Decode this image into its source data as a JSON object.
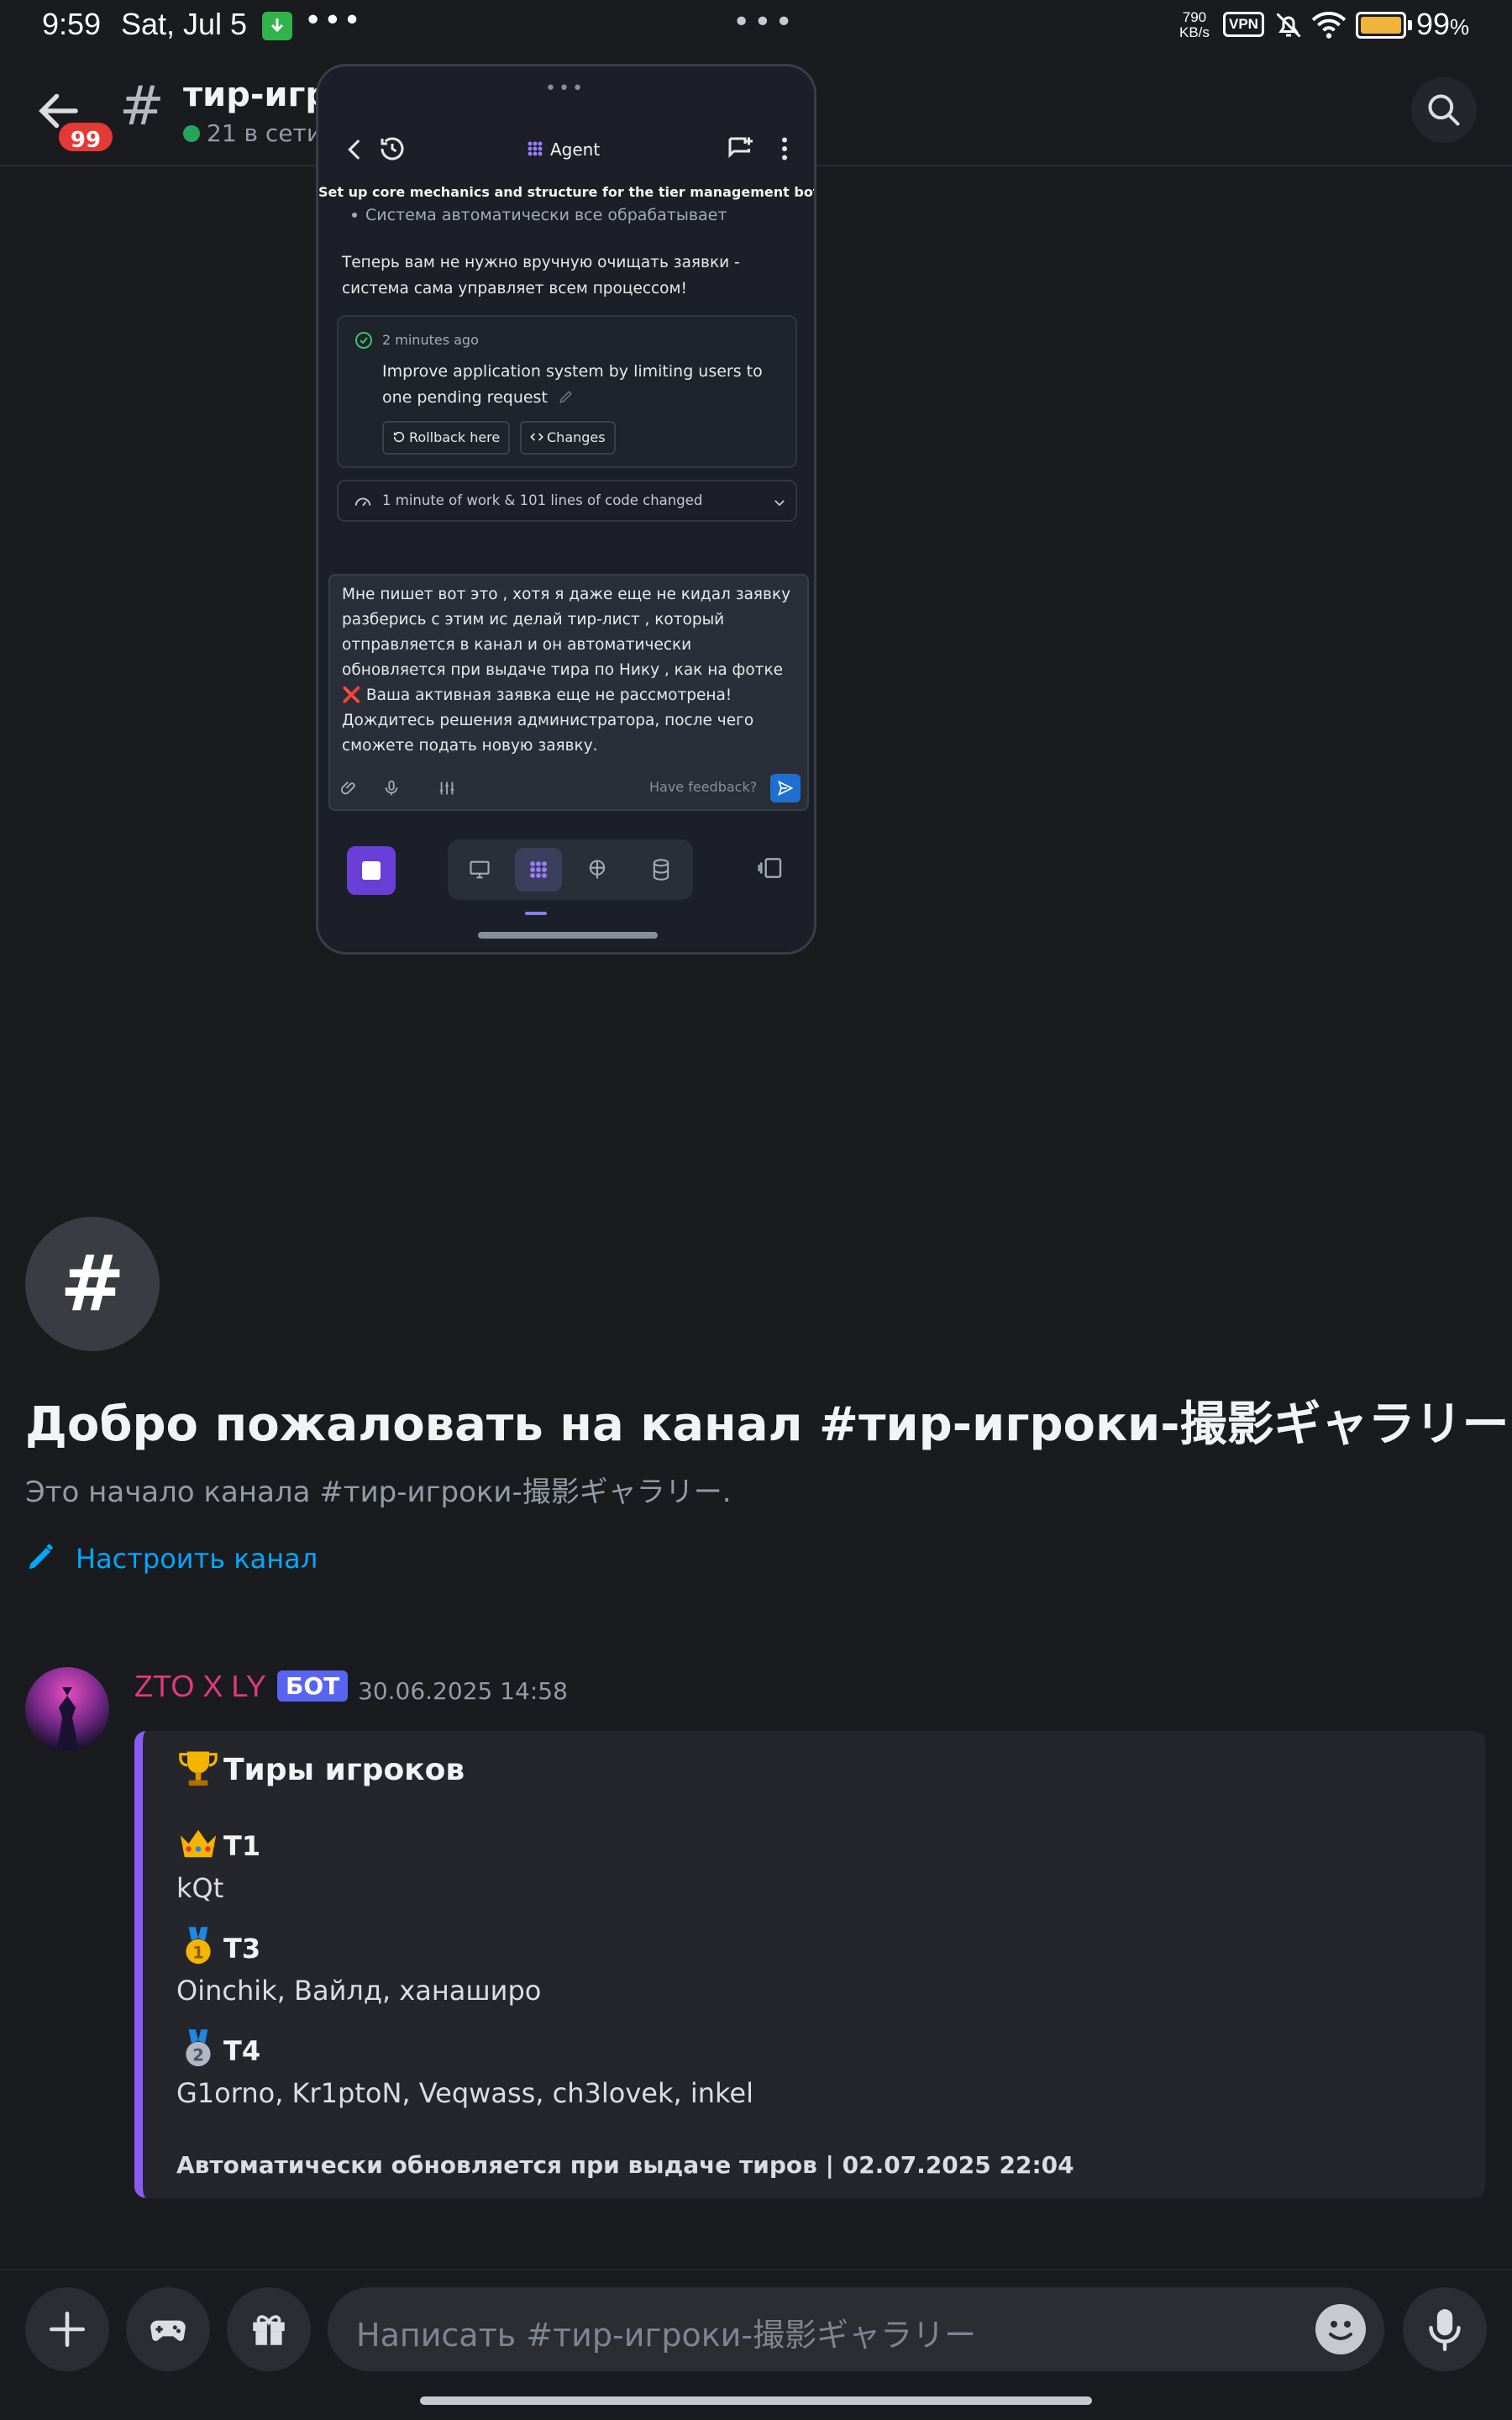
{
  "status_bar": {
    "time": "9:59",
    "date": "Sat, Jul 5",
    "more": "•••",
    "center_dots": "•••",
    "speed_value": "790",
    "speed_unit": "KB/s",
    "vpn": "VPN",
    "battery": "99",
    "battery_unit": "%",
    "battery_color": "#f0b43a"
  },
  "header": {
    "unread_badge": "99",
    "hash": "#",
    "channel_name": "тир-игр",
    "online": "21 в сети"
  },
  "agent_window": {
    "title": "Agent",
    "task_title": "Set up core mechanics and structure for the tier management bot",
    "bullet": "Система автоматически все обрабатывает",
    "paragraph": "Теперь вам не нужно вручную очищать заявки - система сама управляет всем процессом!",
    "checkpoint": {
      "time": "2 minutes ago",
      "text": "Improve application system by limiting users to one pending request",
      "rollback": "Rollback here",
      "changes": "Changes"
    },
    "work_summary": "1 minute of work & 101 lines of code changed",
    "input_text": "Мне пишет вот это , хотя я даже еще не кидал заявку разберись с этим ис делай тир-лист , который отправляется в канал и он автоматически обновляется при выдаче тира по Нику , как на фотке ❌ Ваша активная заявка еще не рассмотрена! Дождитесь решения администратора, после чего сможете подать новую заявку.",
    "feedback": "Have feedback?",
    "accent": "#6a3fd8"
  },
  "welcome": {
    "icon": "#",
    "title": "Добро пожаловать на канал #тир-игроки-撮影ギャラリー!",
    "subtitle": "Это начало канала #тир-игроки-撮影ギャラリー.",
    "setup_link": "Настроить канал"
  },
  "message": {
    "author": "ZTO X LY",
    "author_color": "#e13a78",
    "bot_tag": "БОТ",
    "timestamp": "30.06.2025 14:58",
    "embed": {
      "accent": "#8a5cf6",
      "title": "Тиры игроков",
      "title_icon": "trophy-icon",
      "fields": [
        {
          "icon": "crown-icon",
          "name": "T1",
          "value": "kQt"
        },
        {
          "icon": "gold-medal-icon",
          "name": "T3",
          "value": "Oinchik, Вайлд, ханаширо"
        },
        {
          "icon": "silver-medal-icon",
          "name": "T4",
          "value": "G1orno, Kr1ptoN, Veqwass, ch3lovek, inkel"
        }
      ],
      "footer": "Автоматически обновляется при выдаче тиров | 02.07.2025 22:04"
    }
  },
  "composer": {
    "placeholder": "Написать #тир-игроки-撮影ギャラリー"
  }
}
